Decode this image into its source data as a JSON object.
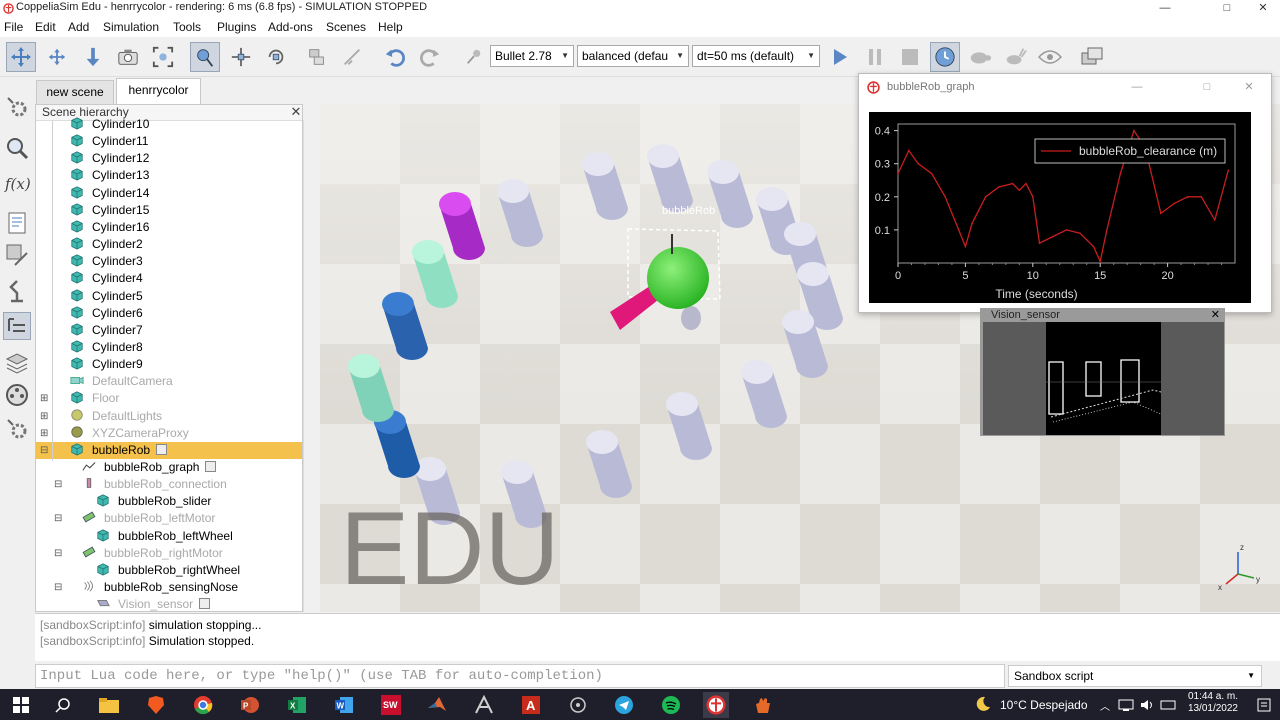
{
  "window": {
    "title": "CoppeliaSim Edu - henrrycolor - rendering: 6 ms (6.8 fps) - SIMULATION STOPPED",
    "min": "—",
    "max": "□",
    "close": "✕"
  },
  "menu": [
    "File",
    "Edit",
    "Add",
    "Simulation",
    "Tools",
    "Plugins",
    "Add-ons",
    "Scenes",
    "Help"
  ],
  "toolbar": {
    "engine": "Bullet 2.78",
    "accuracy": "balanced (defau",
    "timestep": "dt=50 ms (default)"
  },
  "tabs": [
    "new scene",
    "henrrycolor"
  ],
  "hierarchy": {
    "header": "Scene hierarchy",
    "close": "✕",
    "items": [
      {
        "label": "Cylinder10",
        "dim": false
      },
      {
        "label": "Cylinder11",
        "dim": false
      },
      {
        "label": "Cylinder12",
        "dim": false
      },
      {
        "label": "Cylinder13",
        "dim": false
      },
      {
        "label": "Cylinder14",
        "dim": false
      },
      {
        "label": "Cylinder15",
        "dim": false
      },
      {
        "label": "Cylinder16",
        "dim": false
      },
      {
        "label": "Cylinder2",
        "dim": false
      },
      {
        "label": "Cylinder3",
        "dim": false
      },
      {
        "label": "Cylinder4",
        "dim": false
      },
      {
        "label": "Cylinder5",
        "dim": false
      },
      {
        "label": "Cylinder6",
        "dim": false
      },
      {
        "label": "Cylinder7",
        "dim": false
      },
      {
        "label": "Cylinder8",
        "dim": false
      },
      {
        "label": "Cylinder9",
        "dim": false
      },
      {
        "label": "DefaultCamera",
        "dim": true
      },
      {
        "label": "Floor",
        "dim": true
      },
      {
        "label": "DefaultLights",
        "dim": true
      },
      {
        "label": "XYZCameraProxy",
        "dim": true
      },
      {
        "label": "bubbleRob",
        "dim": false
      },
      {
        "label": "bubbleRob_graph",
        "dim": false
      },
      {
        "label": "bubbleRob_connection",
        "dim": true
      },
      {
        "label": "bubbleRob_slider",
        "dim": false
      },
      {
        "label": "bubbleRob_leftMotor",
        "dim": true
      },
      {
        "label": "bubbleRob_leftWheel",
        "dim": false
      },
      {
        "label": "bubbleRob_rightMotor",
        "dim": true
      },
      {
        "label": "bubbleRob_rightWheel",
        "dim": false
      },
      {
        "label": "bubbleRob_sensingNose",
        "dim": false
      },
      {
        "label": "Vision_sensor",
        "dim": true
      }
    ]
  },
  "scene": {
    "robot_label": "bubbleRob",
    "watermark": "EDU",
    "axes": {
      "z": "z",
      "y": "y",
      "x": "x"
    }
  },
  "graph_window": {
    "title": "bubbleRob_graph",
    "min": "—",
    "max": "□",
    "close": "✕"
  },
  "chart_data": {
    "type": "line",
    "title": "",
    "xlabel": "Time (seconds)",
    "ylabel": "",
    "xlim": [
      0,
      25
    ],
    "ylim": [
      0,
      0.42
    ],
    "xticks": [
      "0",
      "5",
      "10",
      "15",
      "20"
    ],
    "yticks": [
      "0.1",
      "0.2",
      "0.3",
      "0.4"
    ],
    "legend_position": "top-right",
    "background": "#000000",
    "series": [
      {
        "name": "bubbleRob_clearance (m)",
        "color": "#c81e1e",
        "x": [
          0,
          0.8,
          1.5,
          2.5,
          3.5,
          4.5,
          5,
          5.5,
          6.5,
          7.5,
          8.5,
          9,
          9.5,
          10,
          10.5,
          11.5,
          12.5,
          13.5,
          14.5,
          15,
          15.5,
          16.5,
          17.5,
          18,
          18.5,
          19.5,
          20.5,
          21.5,
          22.5,
          23.5,
          24.5
        ],
        "values": [
          0.27,
          0.34,
          0.3,
          0.27,
          0.2,
          0.1,
          0.05,
          0.12,
          0.2,
          0.23,
          0.24,
          0.22,
          0.24,
          0.2,
          0.06,
          0.08,
          0.1,
          0.09,
          0.05,
          0.005,
          0.1,
          0.27,
          0.4,
          0.37,
          0.32,
          0.15,
          0.18,
          0.2,
          0.2,
          0.13,
          0.28
        ]
      }
    ]
  },
  "vision": {
    "title": "Vision_sensor",
    "close": "✕"
  },
  "console": [
    {
      "tag": "[sandboxScript:info]",
      "text": "simulation stopping..."
    },
    {
      "tag": "[sandboxScript:info]",
      "text": "Simulation stopped."
    }
  ],
  "input": {
    "placeholder": "Input Lua code here, or type \"help()\" (use TAB for auto-completion)"
  },
  "script_selector": "Sandbox script",
  "taskbar": {
    "weather": "10°C  Despejado",
    "time": "01:44 a. m.",
    "date": "13/01/2022"
  },
  "colors": {
    "selection": "#f4c24c",
    "cube": "#3fb8b0",
    "robot_body": "#3fc93a",
    "nose": "#e0187a"
  }
}
